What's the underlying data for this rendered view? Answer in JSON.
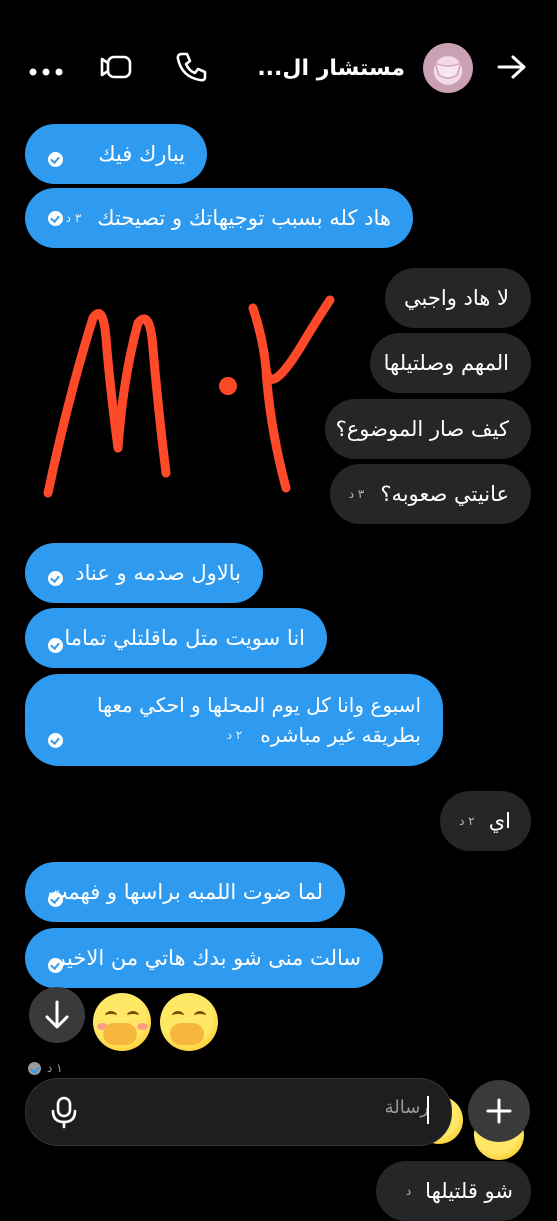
{
  "header": {
    "title": "مستشار ال...",
    "icons": [
      "back-arrow-icon",
      "avatar",
      "phone-icon",
      "video-icon",
      "more-icon"
    ]
  },
  "messages": [
    {
      "side": "sent",
      "text": "يبارك فيك",
      "time": ""
    },
    {
      "side": "sent",
      "text": "هاد كله بسبب توجيهاتك و تصيحتك",
      "time": "٣ د"
    },
    {
      "side": "received",
      "text": "لا هاد واجبي",
      "time": ""
    },
    {
      "side": "received",
      "text": "المهم وصلتيلها",
      "time": ""
    },
    {
      "side": "received",
      "text": "كيف صار الموضوع؟",
      "time": ""
    },
    {
      "side": "received",
      "text": "عانيتي صعوبه؟",
      "time": "٣ د"
    },
    {
      "side": "sent",
      "text": "بالاول صدمه و عناد",
      "time": ""
    },
    {
      "side": "sent",
      "text": "انا سويت متل ماقلتلي تماما",
      "time": ""
    },
    {
      "side": "sent",
      "text_line1": "اسبوع وانا كل يوم المحلها و احكي معها",
      "text_line2": "بطريقه غير مباشره",
      "time": "٢ د"
    },
    {
      "side": "received",
      "text": "اي",
      "time": "٢ د"
    },
    {
      "side": "sent",
      "text": "لما ضوت اللمبه براسها و فهمت",
      "time": ""
    },
    {
      "side": "sent",
      "text": "سالت منى شو بدك هاتي من الاخير",
      "time": ""
    },
    {
      "side": "received",
      "text": "شو قلتيلها",
      "time": "د"
    }
  ],
  "emoji_time": "١ د",
  "annotation": "M·٢",
  "composer": {
    "placeholder": "رسالة"
  },
  "colors": {
    "sent": "#2f9bf0",
    "received": "#262628",
    "annotation": "#ff4a2a"
  }
}
